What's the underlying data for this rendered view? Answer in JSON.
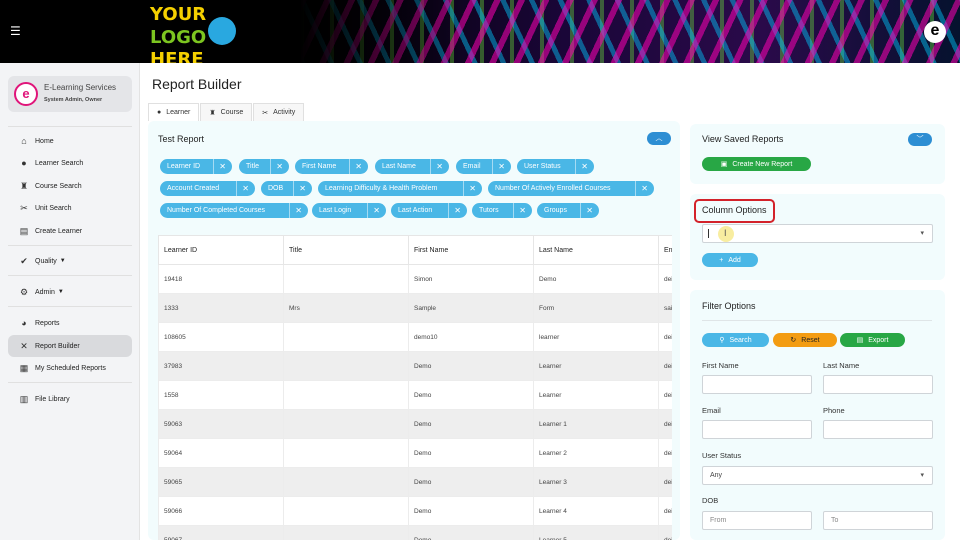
{
  "header": {
    "logo_lines": [
      "YOUR",
      "LOGO",
      "HERE"
    ],
    "brand_letter": "e"
  },
  "sidebar": {
    "brand_title": "E-Learning Services",
    "brand_subtitle": "System Admin, Owner",
    "items": [
      {
        "label": "Home",
        "icon": "home-icon"
      },
      {
        "label": "Learner Search",
        "icon": "user-icon"
      },
      {
        "label": "Course Search",
        "icon": "course-icon"
      },
      {
        "label": "Unit Search",
        "icon": "unit-icon"
      },
      {
        "label": "Create Learner",
        "icon": "clipboard-icon"
      },
      {
        "label": "Quality",
        "icon": "check-circle-icon"
      },
      {
        "label": "Admin",
        "icon": "cogs-icon"
      },
      {
        "label": "Reports",
        "icon": "pie-chart-icon"
      },
      {
        "label": "Report Builder",
        "icon": "tools-icon"
      },
      {
        "label": "My Scheduled Reports",
        "icon": "calendar-icon"
      },
      {
        "label": "File Library",
        "icon": "books-icon"
      }
    ],
    "active": "Report Builder"
  },
  "main": {
    "page_title": "Report Builder",
    "tabs": [
      {
        "label": "Learner",
        "icon": "user-circle-icon"
      },
      {
        "label": "Course",
        "icon": "course-icon"
      },
      {
        "label": "Activity",
        "icon": "activity-icon"
      }
    ],
    "report_title": "Test Report",
    "chips": [
      "Learner ID",
      "Title",
      "First Name",
      "Last Name",
      "Email",
      "User Status",
      "Account Created",
      "DOB",
      "Learning Difficulty & Health Problem",
      "Number Of Actively Enrolled Courses",
      "Number Of Completed Courses",
      "Last Login",
      "Last Action",
      "Tutors",
      "Groups"
    ],
    "table": {
      "columns": [
        "Learner ID",
        "Title",
        "First Name",
        "Last Name",
        "En"
      ],
      "rows": [
        [
          "19418",
          "",
          "Simon",
          "Demo",
          "dei"
        ],
        [
          "1333",
          "Mrs",
          "Sample",
          "Form",
          "sai"
        ],
        [
          "108605",
          "",
          "demo10",
          "learner",
          "dei"
        ],
        [
          "37983",
          "",
          "Demo",
          "Learner",
          "dei"
        ],
        [
          "1558",
          "",
          "Demo",
          "Learner",
          "dei"
        ],
        [
          "59063",
          "",
          "Demo",
          "Learner 1",
          "dei"
        ],
        [
          "59064",
          "",
          "Demo",
          "Learner 2",
          "dei"
        ],
        [
          "59065",
          "",
          "Demo",
          "Learner 3",
          "dei"
        ],
        [
          "59066",
          "",
          "Demo",
          "Learner 4",
          "dei"
        ],
        [
          "59067",
          "",
          "Demo",
          "Learner 5",
          "dei"
        ]
      ]
    }
  },
  "saved_reports": {
    "title": "View Saved Reports",
    "create_button": "Create New Report"
  },
  "column_options": {
    "title": "Column Options",
    "select_value": "",
    "add_button": "Add"
  },
  "filter_options": {
    "title": "Filter Options",
    "search_button": "Search",
    "reset_button": "Reset",
    "export_button": "Export",
    "first_name_label": "First Name",
    "last_name_label": "Last Name",
    "email_label": "Email",
    "phone_label": "Phone",
    "user_status_label": "User Status",
    "user_status_value": "Any",
    "dob_label": "DOB",
    "dob_from_placeholder": "From",
    "dob_to_placeholder": "To"
  },
  "colors": {
    "accent_blue": "#2d8ed3",
    "chip_blue": "#4ab7e6",
    "green": "#28a745",
    "orange": "#f39c12",
    "highlight_red": "#d3222a"
  }
}
